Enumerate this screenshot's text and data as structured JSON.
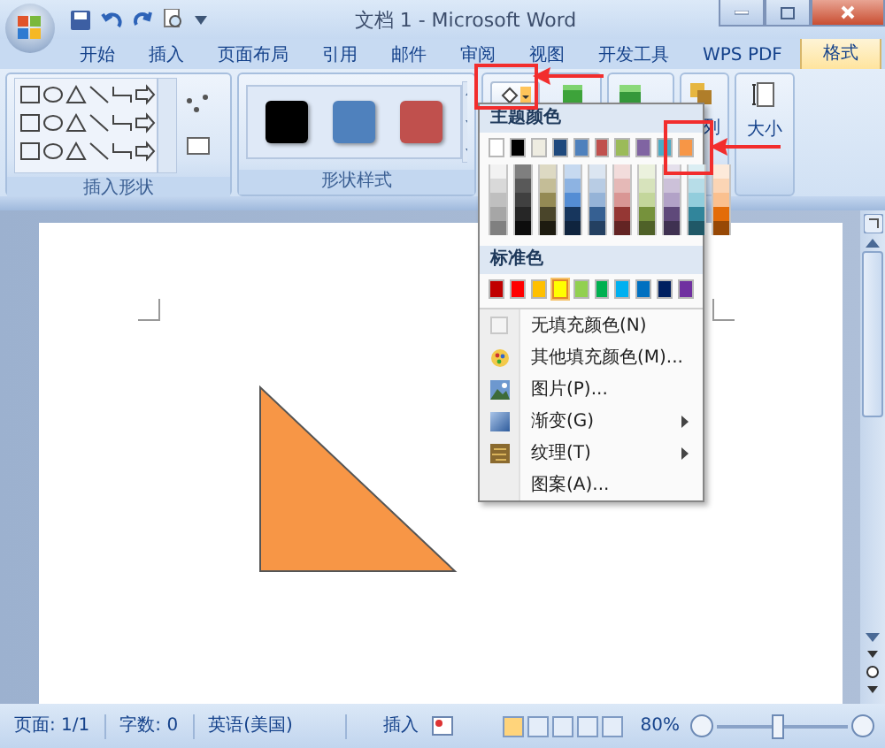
{
  "window": {
    "title": "文档 1 - Microsoft Word"
  },
  "tabs": [
    {
      "label": "开始",
      "selected": false
    },
    {
      "label": "插入",
      "selected": false
    },
    {
      "label": "页面布局",
      "selected": false
    },
    {
      "label": "引用",
      "selected": false
    },
    {
      "label": "邮件",
      "selected": false
    },
    {
      "label": "审阅",
      "selected": false
    },
    {
      "label": "视图",
      "selected": false
    },
    {
      "label": "开发工具",
      "selected": false
    },
    {
      "label": "WPS PDF",
      "selected": false
    },
    {
      "label": "格式",
      "selected": true
    }
  ],
  "ribbon": {
    "shapes_label": "插入形状",
    "styles_label": "形状样式",
    "styles": [
      {
        "color": "#000000"
      },
      {
        "color": "#4f81bd"
      },
      {
        "color": "#c0504d"
      }
    ],
    "partial_label": "列",
    "size_label": "大小"
  },
  "fill_menu": {
    "theme_heading": "主题颜色",
    "theme_colors": [
      {
        "color": "#ffffff",
        "shades": [
          {
            "color": "#f2f2f2"
          },
          {
            "color": "#d9d9d9"
          },
          {
            "color": "#bfbfbf"
          },
          {
            "color": "#a6a6a6"
          },
          {
            "color": "#808080"
          }
        ]
      },
      {
        "color": "#000000",
        "shades": [
          {
            "color": "#7f7f7f"
          },
          {
            "color": "#595959"
          },
          {
            "color": "#404040"
          },
          {
            "color": "#262626"
          },
          {
            "color": "#0d0d0d"
          }
        ]
      },
      {
        "color": "#eeece1",
        "shades": [
          {
            "color": "#ddd9c3"
          },
          {
            "color": "#c4bd97"
          },
          {
            "color": "#948a54"
          },
          {
            "color": "#4a452a"
          },
          {
            "color": "#1d1b10"
          }
        ]
      },
      {
        "color": "#1f497d",
        "shades": [
          {
            "color": "#c6d9f0"
          },
          {
            "color": "#8db3e2"
          },
          {
            "color": "#548dd4"
          },
          {
            "color": "#17365d"
          },
          {
            "color": "#0f243e"
          }
        ]
      },
      {
        "color": "#4f81bd",
        "shades": [
          {
            "color": "#dbe5f1"
          },
          {
            "color": "#b8cce4"
          },
          {
            "color": "#95b3d7"
          },
          {
            "color": "#366092"
          },
          {
            "color": "#244061"
          }
        ]
      },
      {
        "color": "#c0504d",
        "shades": [
          {
            "color": "#f2dcdb"
          },
          {
            "color": "#e5b9b7"
          },
          {
            "color": "#d99694"
          },
          {
            "color": "#953734"
          },
          {
            "color": "#632423"
          }
        ]
      },
      {
        "color": "#9bbb59",
        "shades": [
          {
            "color": "#ebf1dd"
          },
          {
            "color": "#d7e3bc"
          },
          {
            "color": "#c3d69b"
          },
          {
            "color": "#76923c"
          },
          {
            "color": "#4f6128"
          }
        ]
      },
      {
        "color": "#8064a2",
        "shades": [
          {
            "color": "#e5e0ec"
          },
          {
            "color": "#ccc1d9"
          },
          {
            "color": "#b2a2c7"
          },
          {
            "color": "#5f497a"
          },
          {
            "color": "#3f3151"
          }
        ]
      },
      {
        "color": "#4bacc6",
        "shades": [
          {
            "color": "#dbeef3"
          },
          {
            "color": "#b7dde8"
          },
          {
            "color": "#92cddc"
          },
          {
            "color": "#31859b"
          },
          {
            "color": "#205867"
          }
        ]
      },
      {
        "color": "#f79646",
        "shades": [
          {
            "color": "#fdeada"
          },
          {
            "color": "#fbd5b5"
          },
          {
            "color": "#fac08f"
          },
          {
            "color": "#e36c09"
          },
          {
            "color": "#974806"
          }
        ]
      }
    ],
    "standard_heading": "标准色",
    "standard_colors": [
      {
        "color": "#c00000",
        "selected": false
      },
      {
        "color": "#ff0000",
        "selected": false
      },
      {
        "color": "#ffc000",
        "selected": false
      },
      {
        "color": "#ffff00",
        "selected": true
      },
      {
        "color": "#92d050",
        "selected": false
      },
      {
        "color": "#00b050",
        "selected": false
      },
      {
        "color": "#00b0f0",
        "selected": false
      },
      {
        "color": "#0070c0",
        "selected": false
      },
      {
        "color": "#002060",
        "selected": false
      },
      {
        "color": "#7030a0",
        "selected": false
      }
    ],
    "items": [
      {
        "label": "无填充颜色(N)",
        "submenu": false
      },
      {
        "label": "其他填充颜色(M)...",
        "submenu": false
      },
      {
        "label": "图片(P)...",
        "submenu": false
      },
      {
        "label": "渐变(G)",
        "submenu": true
      },
      {
        "label": "纹理(T)",
        "submenu": true
      },
      {
        "label": "图案(A)...",
        "submenu": false
      }
    ]
  },
  "document": {
    "shape": {
      "kind": "right-triangle",
      "color": "#f79646"
    }
  },
  "status_bar": {
    "page": "页面: 1/1",
    "words": "字数: 0",
    "language": "英语(美国)",
    "mode": "插入",
    "zoom": "80%",
    "zoom_slider": {
      "level": 0.45
    }
  }
}
